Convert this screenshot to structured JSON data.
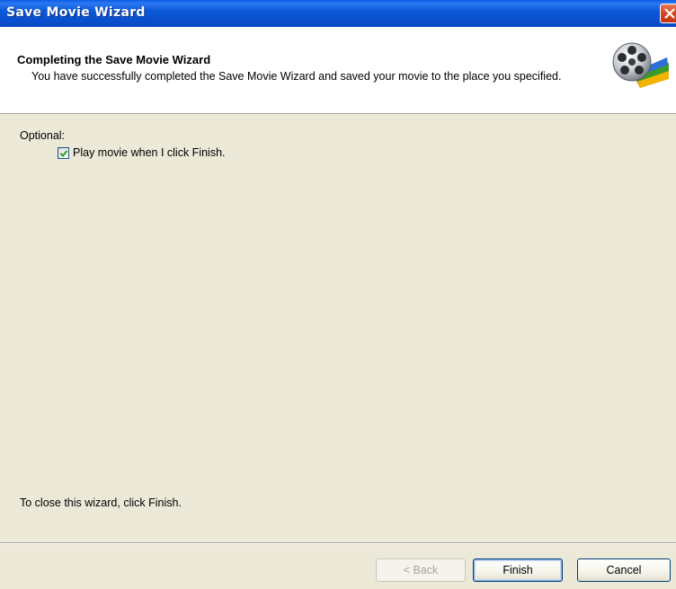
{
  "window": {
    "title": "Save Movie Wizard"
  },
  "header": {
    "title": "Completing the Save Movie Wizard",
    "description": "You have successfully completed the Save Movie Wizard and saved your movie to the place you specified.",
    "icon": "movie-maker-film-reel-icon"
  },
  "content": {
    "optional_label": "Optional:",
    "play_checkbox": {
      "label": "Play movie when I click Finish.",
      "checked": true
    },
    "close_hint": "To close this wizard, click Finish."
  },
  "buttons": {
    "back": "< Back",
    "finish": "Finish",
    "cancel": "Cancel"
  },
  "colors": {
    "titlebar": "#0a50cf",
    "dialog_background": "#ece9d8",
    "header_background": "#ffffff",
    "close_button": "#d6451e",
    "checkmark": "#21a121"
  }
}
